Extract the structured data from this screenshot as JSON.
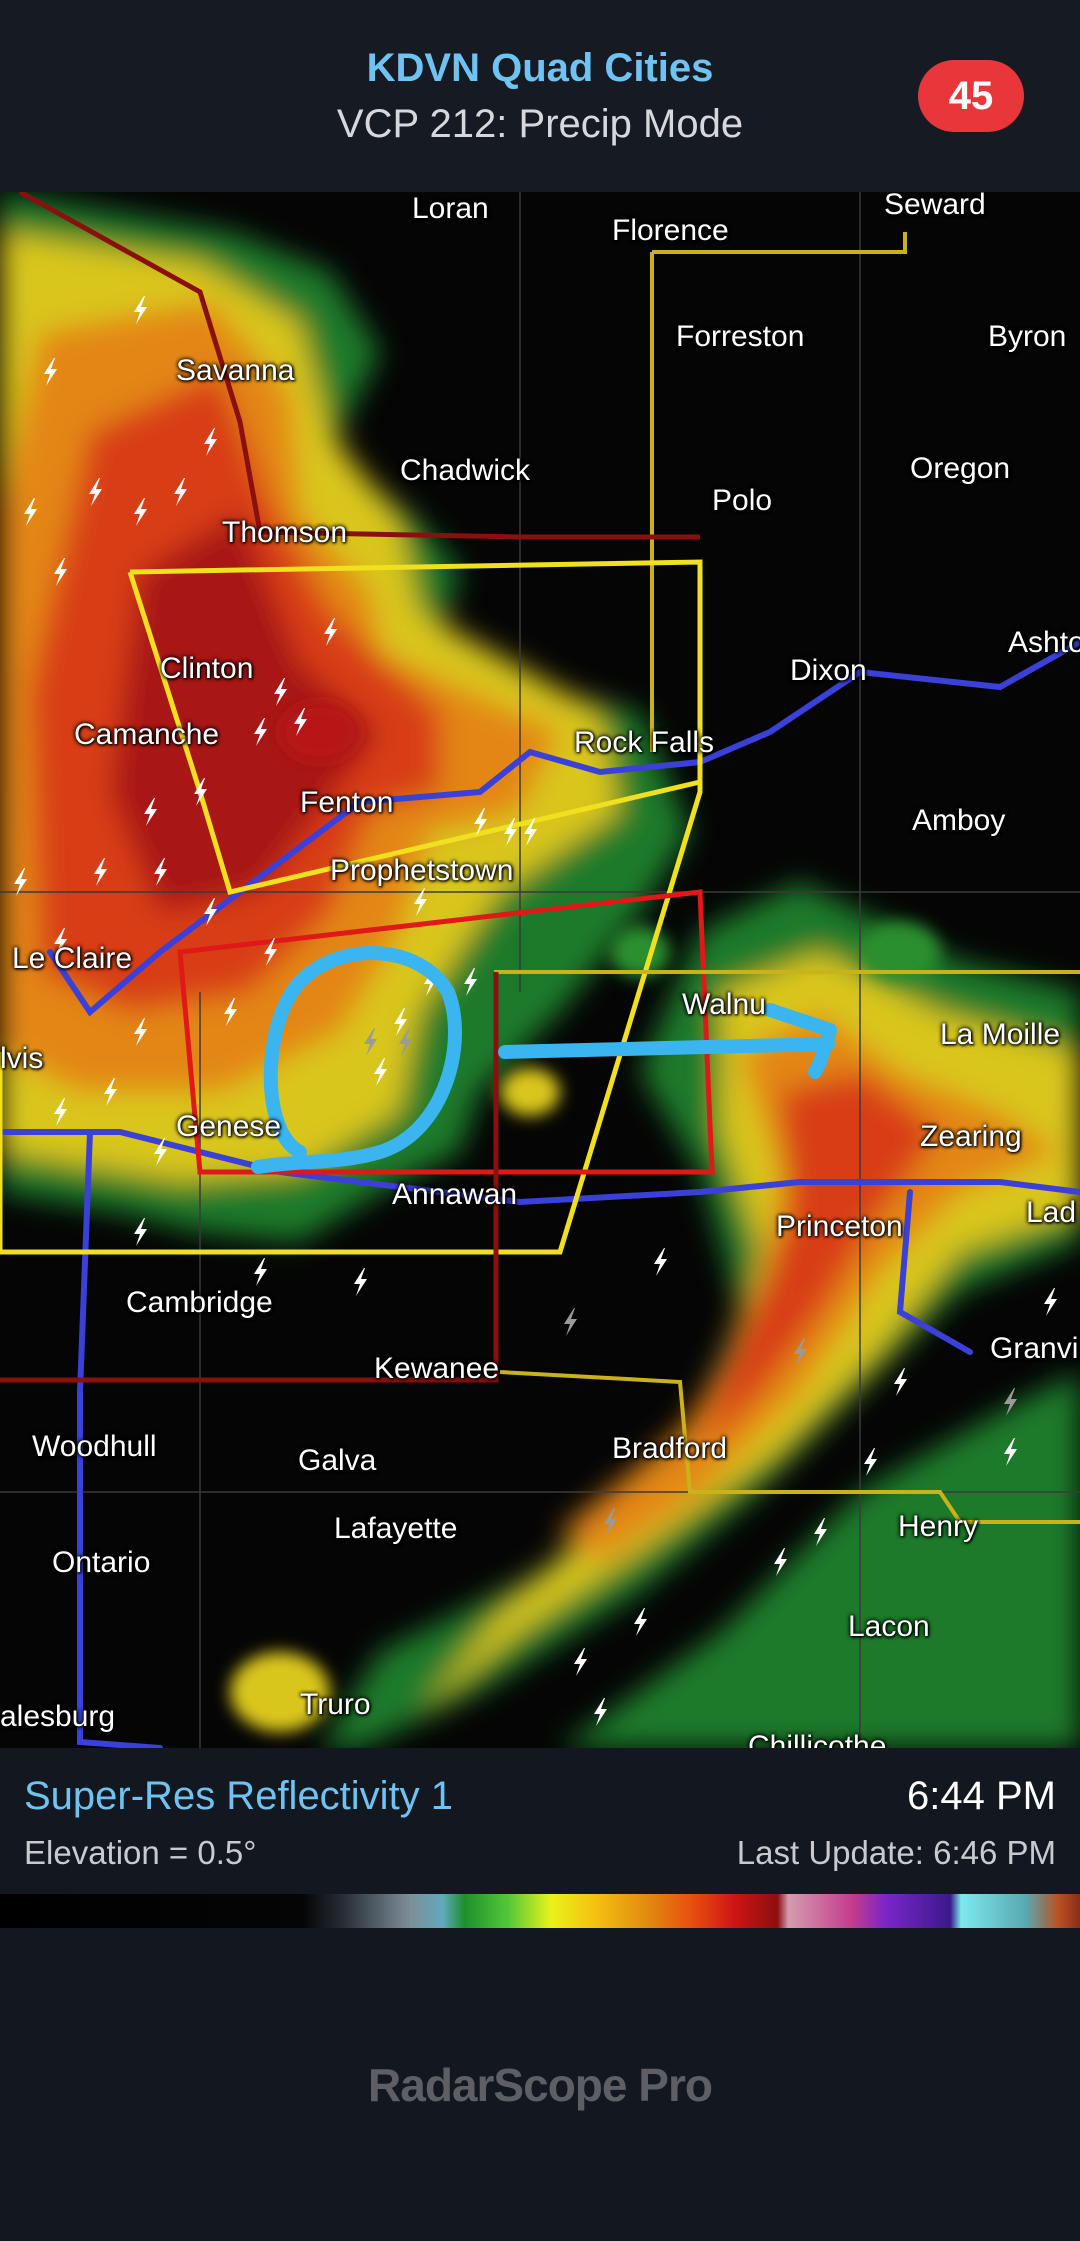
{
  "header": {
    "station_title": "KDVN Quad Cities",
    "mode": "VCP 212: Precip Mode",
    "badge_count": "45"
  },
  "map": {
    "cities": [
      "Loran",
      "Florence",
      "Seward",
      "Forreston",
      "Byron",
      "Savanna",
      "Chadwick",
      "Oregon",
      "Polo",
      "Thomson",
      "Clinton",
      "Dixon",
      "Ashto",
      "Camanche",
      "Rock Falls",
      "Fenton",
      "Amboy",
      "Prophetstown",
      "Le Claire",
      "Walnu",
      "La Moille",
      "lvis",
      "Genese",
      "Zearing",
      "Annawan",
      "Princeton",
      "Lad",
      "Cambridge",
      "Granvi",
      "Kewanee",
      "Woodhull",
      "Galva",
      "Bradford",
      "Lafayette",
      "Henry",
      "Ontario",
      "Lacon",
      "Truro",
      "alesburg",
      "Chillicothe"
    ],
    "annotation": "hand-drawn-circle-and-arrow"
  },
  "footer": {
    "product": "Super-Res Reflectivity 1",
    "scan_time": "6:44 PM",
    "elevation": "Elevation = 0.5°",
    "last_update": "Last Update: 6:46 PM",
    "brand": "RadarScope Pro"
  },
  "colors": {
    "accent": "#6fc3f3",
    "badge": "#e8363a",
    "annotation": "#3ab5ef",
    "warning_red": "#e01818",
    "watch_yellow": "#e6d62a"
  }
}
